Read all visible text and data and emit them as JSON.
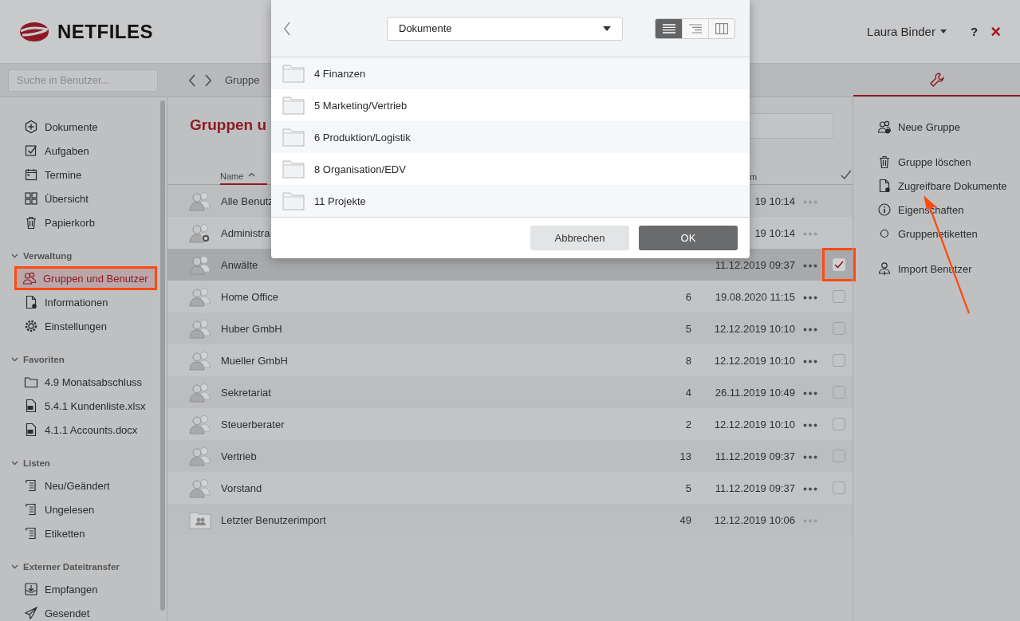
{
  "header": {
    "logo_text": "NETFILES",
    "user": "Laura Binder",
    "help": "?",
    "close": "×"
  },
  "toolbar": {
    "search_placeholder": "Suche in Benutzer...",
    "breadcrumb": "Gruppe"
  },
  "sidebar": {
    "items": [
      {
        "label": "Dokumente",
        "kind": "plus",
        "selected": false,
        "annotated": false
      },
      {
        "label": "Aufgaben",
        "kind": "task",
        "selected": false,
        "annotated": false
      },
      {
        "label": "Termine",
        "kind": "calendar",
        "selected": false,
        "annotated": false
      },
      {
        "label": "Übersicht",
        "kind": "grid",
        "selected": false,
        "annotated": false
      },
      {
        "label": "Papierkorb",
        "kind": "trash",
        "selected": false,
        "annotated": false
      }
    ],
    "sections": [
      {
        "title": "Verwaltung",
        "expanded": true,
        "items": [
          {
            "label": "Gruppen und Benutzer",
            "kind": "group",
            "selected": true,
            "annotated": true
          },
          {
            "label": "Informationen",
            "kind": "doc",
            "selected": false,
            "annotated": false
          },
          {
            "label": "Einstellungen",
            "kind": "gear",
            "selected": false,
            "annotated": false
          }
        ]
      },
      {
        "title": "Favoriten",
        "expanded": true,
        "items": [
          {
            "label": "4.9 Monatsabschluss",
            "kind": "folder",
            "selected": false,
            "annotated": false
          },
          {
            "label": "5.4.1 Kundenliste.xlsx",
            "kind": "file",
            "selected": false,
            "annotated": false
          },
          {
            "label": "4.1.1 Accounts.docx",
            "kind": "file",
            "selected": false,
            "annotated": false
          }
        ]
      },
      {
        "title": "Listen",
        "expanded": true,
        "items": [
          {
            "label": "Neu/Geändert",
            "kind": "list",
            "selected": false,
            "annotated": false
          },
          {
            "label": "Ungelesen",
            "kind": "list",
            "selected": false,
            "annotated": false
          },
          {
            "label": "Etiketten",
            "kind": "list",
            "selected": false,
            "annotated": false
          }
        ]
      },
      {
        "title": "Externer Dateitransfer",
        "expanded": true,
        "items": [
          {
            "label": "Empfangen",
            "kind": "inbox",
            "selected": false,
            "annotated": false
          },
          {
            "label": "Gesendet",
            "kind": "send",
            "selected": false,
            "annotated": false
          }
        ]
      }
    ]
  },
  "main": {
    "title": "Gruppen u",
    "columns": {
      "name": "Name",
      "column_3": "m"
    },
    "rows": [
      {
        "name": "Alle Benutz",
        "count": "",
        "date": "19 10:14",
        "kind": "group",
        "selected": false,
        "checkable": false,
        "actions_enabled": false,
        "annotated": false
      },
      {
        "name": "Administra",
        "count": "",
        "date": "19 10:14",
        "kind": "admin",
        "selected": false,
        "checkable": false,
        "actions_enabled": false,
        "annotated": false
      },
      {
        "name": "Anwälte",
        "count": "",
        "date": "11.12.2019 09:37",
        "kind": "group",
        "selected": true,
        "checkable": true,
        "checked": true,
        "actions_enabled": true,
        "annotated": true
      },
      {
        "name": "Home Office",
        "count": "6",
        "date": "19.08.2020 11:15",
        "kind": "group",
        "selected": false,
        "checkable": true,
        "checked": false,
        "actions_enabled": true,
        "annotated": false
      },
      {
        "name": "Huber GmbH",
        "count": "5",
        "date": "12.12.2019 10:10",
        "kind": "group",
        "selected": false,
        "checkable": true,
        "checked": false,
        "actions_enabled": true,
        "annotated": false
      },
      {
        "name": "Mueller GmbH",
        "count": "8",
        "date": "12.12.2019 10:10",
        "kind": "group",
        "selected": false,
        "checkable": true,
        "checked": false,
        "actions_enabled": true,
        "annotated": false
      },
      {
        "name": "Sekretariat",
        "count": "4",
        "date": "26.11.2019 10:49",
        "kind": "group",
        "selected": false,
        "checkable": true,
        "checked": false,
        "actions_enabled": true,
        "annotated": false
      },
      {
        "name": "Steuerberater",
        "count": "2",
        "date": "12.12.2019 10:10",
        "kind": "group",
        "selected": false,
        "checkable": true,
        "checked": false,
        "actions_enabled": true,
        "annotated": false
      },
      {
        "name": "Vertrieb",
        "count": "13",
        "date": "11.12.2019 09:37",
        "kind": "group",
        "selected": false,
        "checkable": true,
        "checked": false,
        "actions_enabled": true,
        "annotated": false
      },
      {
        "name": "Vorstand",
        "count": "5",
        "date": "11.12.2019 09:37",
        "kind": "group",
        "selected": false,
        "checkable": true,
        "checked": false,
        "actions_enabled": true,
        "annotated": false
      },
      {
        "name": "Letzter Benutzerimport",
        "count": "49",
        "date": "12.12.2019 10:06",
        "kind": "folder",
        "selected": false,
        "checkable": false,
        "actions_enabled": false,
        "annotated": false
      }
    ]
  },
  "actions": {
    "groups": [
      [
        {
          "label": "Neue Gruppe",
          "kind": "group-add"
        }
      ],
      [
        {
          "label": "Gruppe löschen",
          "kind": "trash"
        },
        {
          "label": "Zugreifbare Dokumente",
          "kind": "doc"
        },
        {
          "label": "Eigenschaften",
          "kind": "info"
        },
        {
          "label": "Gruppenetiketten",
          "kind": "circle"
        }
      ],
      [
        {
          "label": "Import Benutzer",
          "kind": "person"
        }
      ]
    ]
  },
  "dialog": {
    "location": "Dokumente",
    "view_modes": [
      {
        "kind": "list",
        "selected": true
      },
      {
        "kind": "tree",
        "selected": false
      },
      {
        "kind": "columns",
        "selected": false
      }
    ],
    "folders": [
      "4 Finanzen",
      "5 Marketing/Vertrieb",
      "6 Produktion/Logistik",
      "8 Organisation/EDV",
      "11 Projekte"
    ],
    "buttons": [
      {
        "label": "Abbrechen",
        "kind": "secondary"
      },
      {
        "label": "OK",
        "kind": "primary"
      }
    ]
  }
}
